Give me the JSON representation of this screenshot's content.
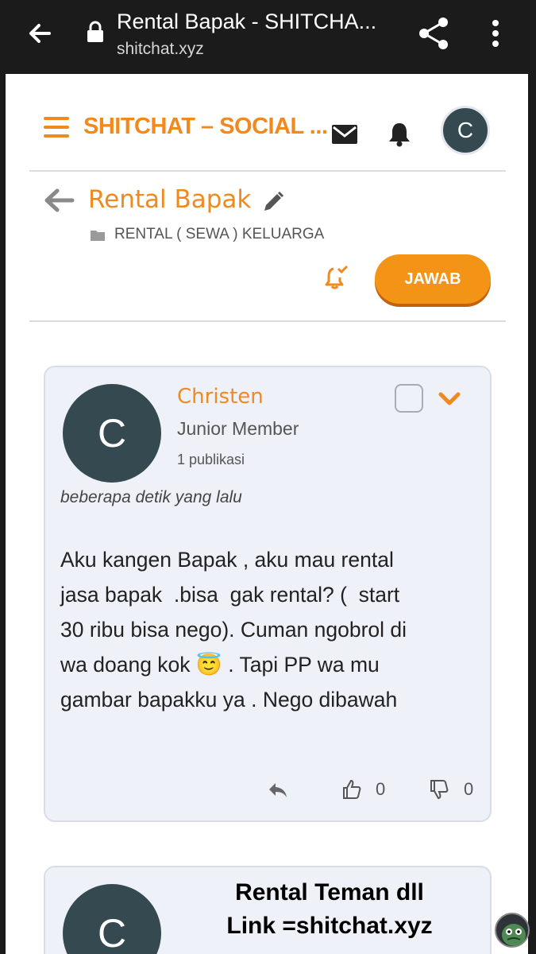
{
  "browser": {
    "title": "Rental Bapak - SHITCHA...",
    "url": "shitchat.xyz"
  },
  "header": {
    "site_title": "SHITCHAT – SOCIAL ...",
    "avatar_letter": "C"
  },
  "topic": {
    "title": "Rental Bapak",
    "category": "RENTAL ( SEWA ) KELUARGA",
    "reply_label": "JAWAB"
  },
  "post": {
    "avatar_letter": "C",
    "author": "Christen",
    "rank": "Junior Member",
    "pub_count": "1 publikasi",
    "timestamp": "beberapa detik yang lalu",
    "body": "Aku kangen Bapak , aku mau rental\njasa bapak  .bisa  gak rental? (  start\n30 ribu bisa nego). Cuman ngobrol di\nwa doang kok 😇 . Tapi PP wa mu\ngambar bapakku ya . Nego dibawah",
    "likes": "0",
    "dislikes": "0"
  },
  "post2": {
    "avatar_letter": "C"
  },
  "overlay": {
    "line1": "Rental Teman dll",
    "line2": "Link =shitchat.xyz"
  },
  "colors": {
    "accent": "#f18a1e",
    "avatar_bg": "#354a50",
    "card_bg": "#eef1f7"
  }
}
